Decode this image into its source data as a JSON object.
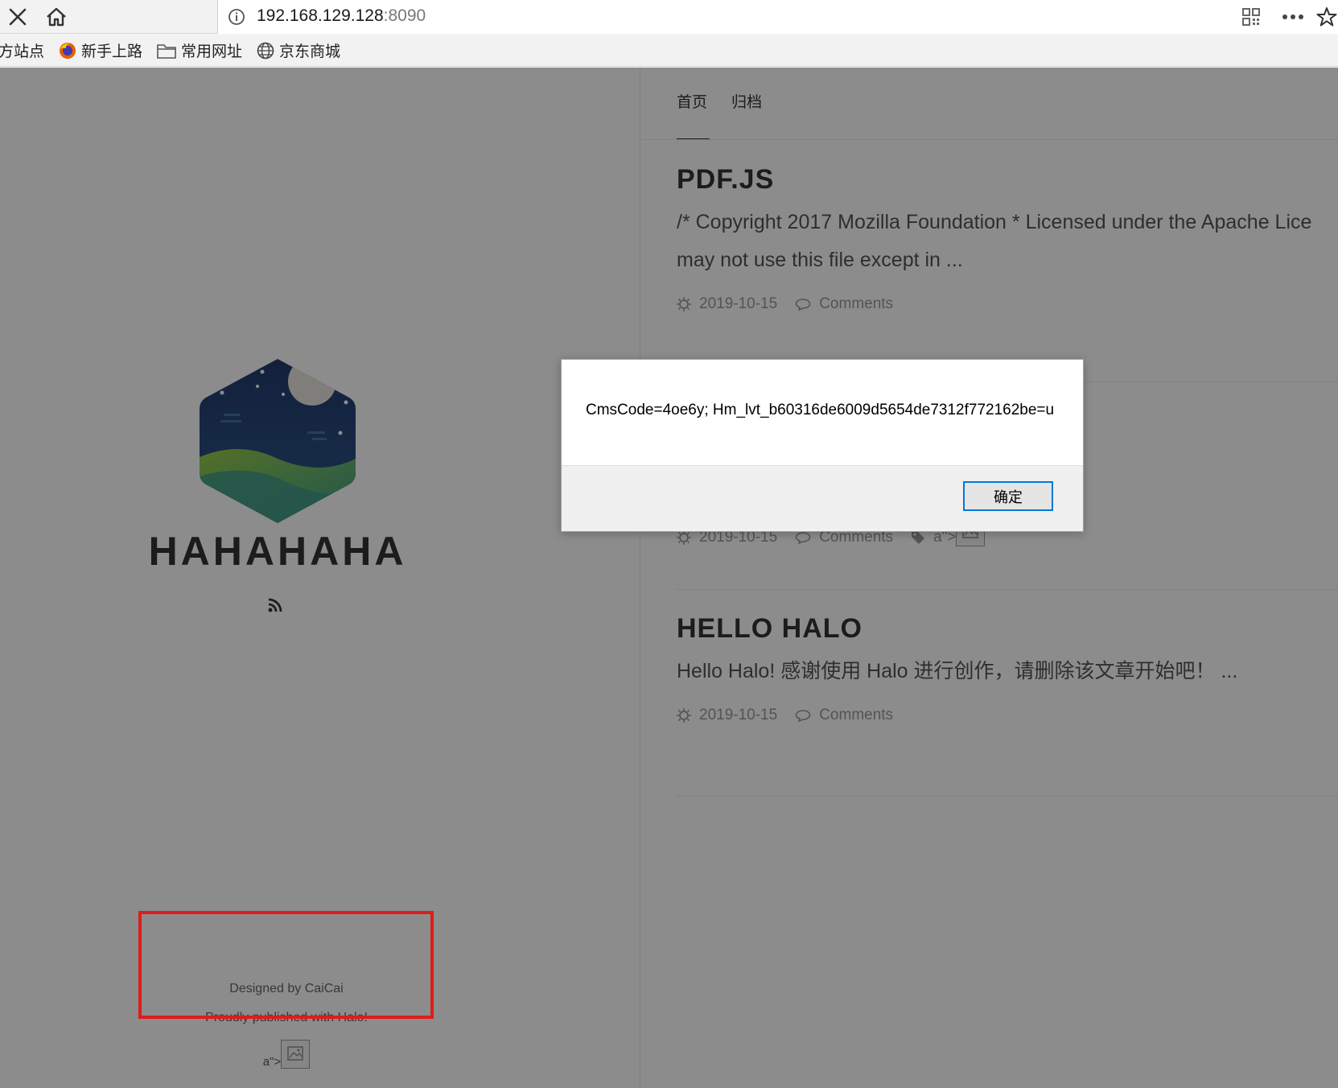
{
  "browser": {
    "url_host": "192.168.129.128",
    "url_port": ":8090",
    "bookmarks": [
      "方站点",
      "新手上路",
      "常用网址",
      "京东商城"
    ]
  },
  "blog": {
    "site_title": "HAHAHAHA",
    "nav": [
      "首页",
      "归档"
    ],
    "posts": [
      {
        "title": "PDF.JS",
        "excerpt_line1": "/* Copyright 2017 Mozilla Foundation * Licensed under the Apache Lice",
        "excerpt_line2": "may not use this file except in ...",
        "date": "2019-10-15",
        "comments": "Comments"
      },
      {
        "date": "2019-10-15",
        "comments": "Comments",
        "tag_text": "a\">"
      },
      {
        "title": "HELLO HALO",
        "excerpt_line1": "Hello Halo! 感谢使用 Halo 进行创作，请删除该文章开始吧！ ...",
        "date": "2019-10-15",
        "comments": "Comments"
      }
    ],
    "footer": {
      "designed_by": "Designed by CaiCai",
      "published": "Proudly published with Halo!",
      "tail": "a\">"
    }
  },
  "dialog": {
    "message": "CmsCode=4oe6y; Hm_lvt_b60316de6009d5654de7312f772162be=u",
    "ok_label": "确定"
  },
  "colors": {
    "highlight_box": "#e01b1b",
    "dialog_button_border": "#0078d7"
  }
}
